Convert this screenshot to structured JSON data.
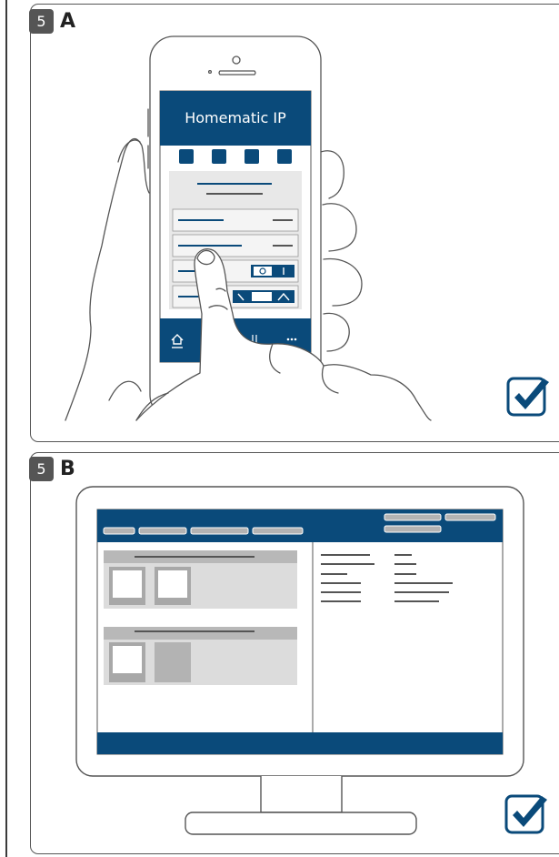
{
  "steps": [
    {
      "number": "5",
      "letter": "A"
    },
    {
      "number": "5",
      "letter": "B"
    }
  ],
  "phone": {
    "app_title": "Homematic IP"
  },
  "icons": {
    "check": "checkbox-checked-icon",
    "home": "home-icon",
    "more": "more-icon",
    "toggle": "on-off-toggle-icon",
    "chevron": "chevron-up-icon"
  },
  "colors": {
    "brand_blue": "#0a4a7a",
    "outline": "#555555",
    "panel_grey": "#dcdcdc",
    "tile_grey": "#b3b3b3"
  }
}
